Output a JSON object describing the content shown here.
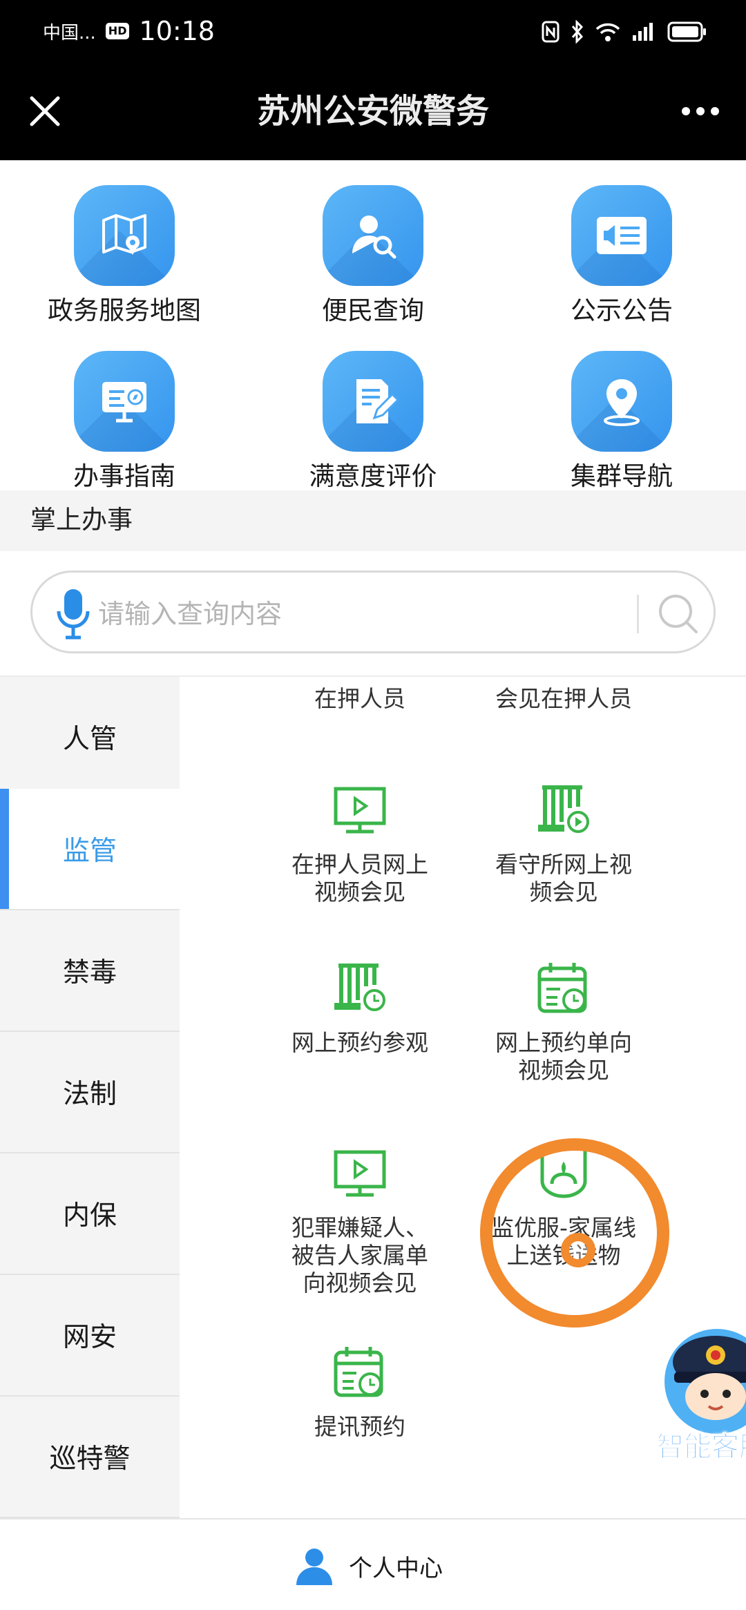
{
  "status_bar": {
    "carrier": "中国...",
    "hd": "HD",
    "time": "10:18"
  },
  "title_bar": {
    "title": "苏州公安微警务"
  },
  "quick_grid": [
    {
      "label": "政务服务地图",
      "icon": "map-icon"
    },
    {
      "label": "便民查询",
      "icon": "user-search-icon"
    },
    {
      "label": "公示公告",
      "icon": "announcement-icon"
    },
    {
      "label": "办事指南",
      "icon": "guide-icon"
    },
    {
      "label": "满意度评价",
      "icon": "edit-review-icon"
    },
    {
      "label": "集群导航",
      "icon": "location-pin-icon"
    }
  ],
  "section_title": "掌上办事",
  "search": {
    "placeholder": "请输入查询内容",
    "value": ""
  },
  "categories": [
    {
      "label": "人管",
      "active": false
    },
    {
      "label": "监管",
      "active": true
    },
    {
      "label": "禁毒",
      "active": false
    },
    {
      "label": "法制",
      "active": false
    },
    {
      "label": "内保",
      "active": false
    },
    {
      "label": "网安",
      "active": false
    },
    {
      "label": "巡特警",
      "active": false
    }
  ],
  "services": [
    {
      "label": "在押人员",
      "icon": "none"
    },
    {
      "label": "会见在押人员",
      "icon": "none"
    },
    {
      "label": "在押人员网上视频会见",
      "icon": "monitor-play-icon"
    },
    {
      "label": "看守所网上视频会见",
      "icon": "bars-play-icon"
    },
    {
      "label": "网上预约参观",
      "icon": "bars-clock-icon"
    },
    {
      "label": "网上预约单向视频会见",
      "icon": "calendar-clock-icon"
    },
    {
      "label": "犯罪嫌疑人、被告人家属单向视频会见",
      "icon": "monitor-play-icon"
    },
    {
      "label": "监优服-家属线上送钱送物",
      "icon": "gift-bag-icon"
    },
    {
      "label": "提讯预约",
      "icon": "calendar-clock-icon"
    }
  ],
  "assistant": {
    "label": "智能客服"
  },
  "bottom_bar": {
    "label": "个人中心"
  },
  "colors": {
    "accent": "#3a9be8",
    "service_green": "#3ab54a",
    "tap_ring": "#f28a2e"
  }
}
